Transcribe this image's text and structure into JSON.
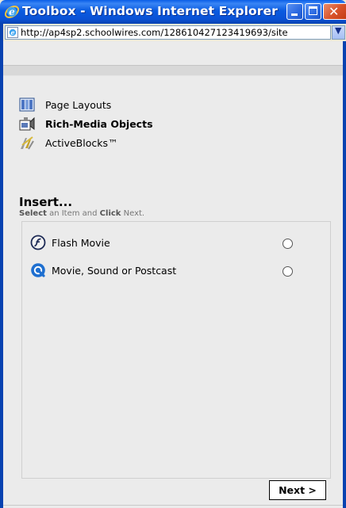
{
  "window": {
    "title": "Toolbox - Windows Internet Explorer",
    "icon": "ie-icon",
    "controls": [
      "minimize",
      "maximize",
      "close"
    ]
  },
  "address_bar": {
    "url": "http://ap4sp2.schoolwires.com/128610427123419693/site",
    "icon": "ie-page-icon"
  },
  "categories": [
    {
      "label": "Page Layouts",
      "icon": "page-layouts-icon",
      "active": false
    },
    {
      "label": "Rich-Media Objects",
      "icon": "rich-media-icon",
      "active": true
    },
    {
      "label": "ActiveBlocks™",
      "icon": "activeblocks-icon",
      "active": false
    }
  ],
  "insert": {
    "heading": "Insert...",
    "subtitle_parts": [
      "Select",
      " an Item and ",
      "Click",
      " Next."
    ]
  },
  "items": [
    {
      "label": "Flash Movie",
      "icon": "flash-icon",
      "selected": false
    },
    {
      "label": "Movie, Sound or Postcast",
      "icon": "quicktime-icon",
      "selected": false
    }
  ],
  "next_button": {
    "label": "Next >"
  },
  "colors": {
    "titlebar": "#0a52d6",
    "close": "#d8522a",
    "content_bg": "#ebebeb"
  }
}
